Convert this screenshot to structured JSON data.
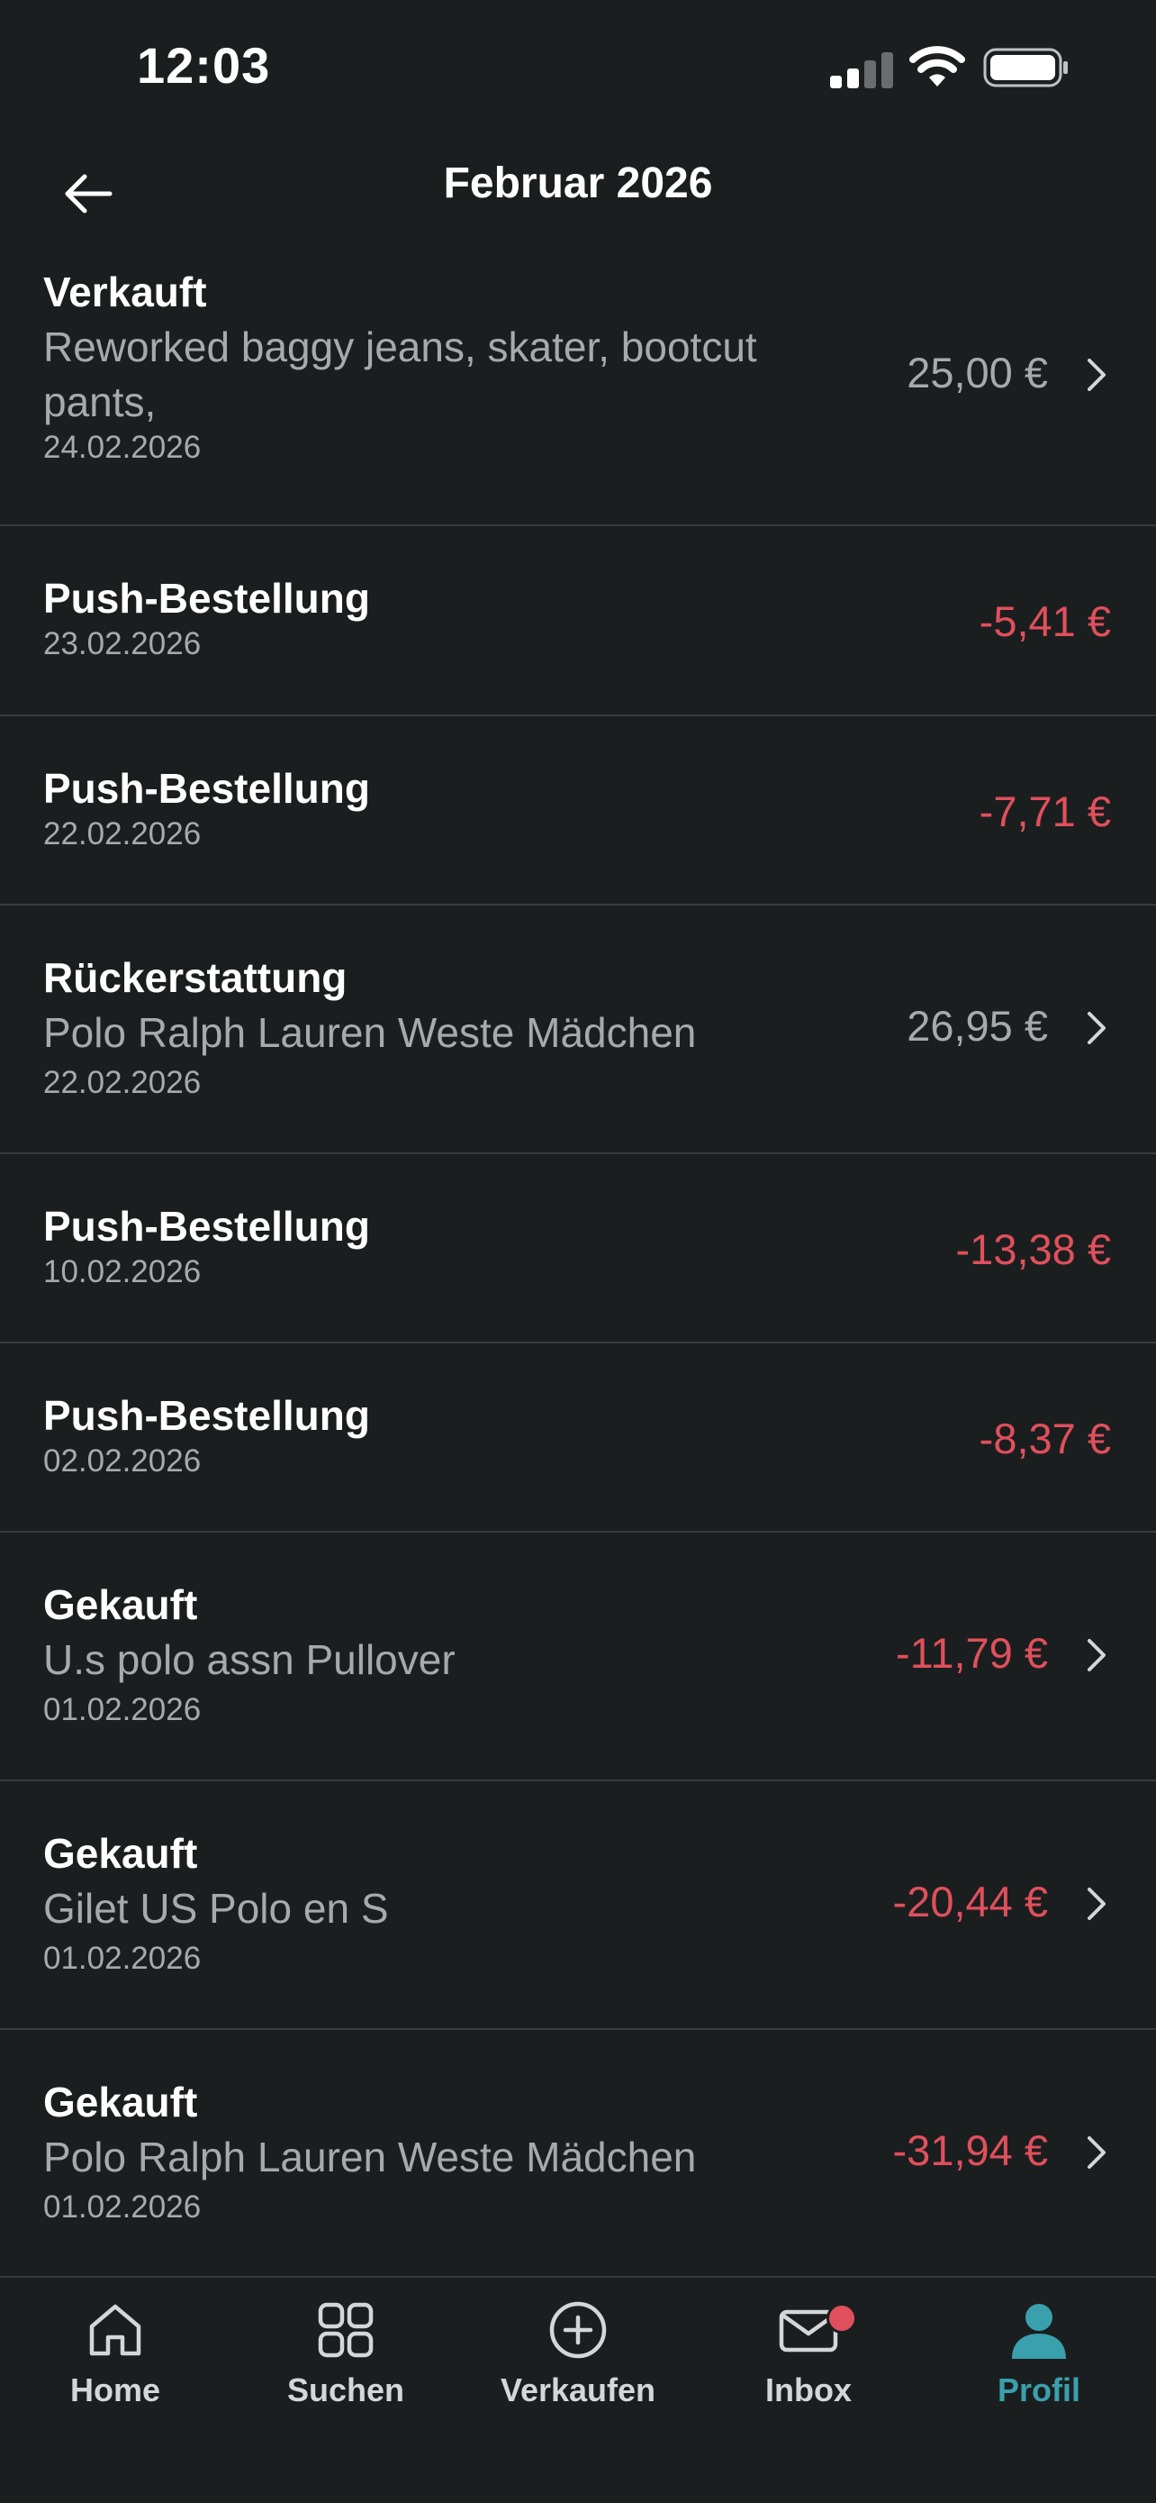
{
  "status_bar": {
    "time": "12:03",
    "signal_icon": "cellular-signal-icon",
    "wifi_icon": "wifi-icon",
    "battery_icon": "battery-icon"
  },
  "header": {
    "title": "Februar 2026",
    "back_icon": "arrow-left-icon"
  },
  "transactions": [
    {
      "title": "Verkauft",
      "subtitle_line1": "Reworked baggy jeans, skater, bootcut",
      "subtitle_line2": "pants,",
      "date": "24.02.2026",
      "amount": "25,00 €",
      "type": "positive",
      "has_chevron": true
    },
    {
      "title": "Push-Bestellung",
      "date": "23.02.2026",
      "amount": "-5,41 €",
      "type": "negative",
      "has_chevron": false
    },
    {
      "title": "Push-Bestellung",
      "date": "22.02.2026",
      "amount": "-7,71 €",
      "type": "negative",
      "has_chevron": false
    },
    {
      "title": "Rückerstattung",
      "subtitle_line1": "Polo Ralph Lauren Weste Mädchen",
      "date": "22.02.2026",
      "amount": "26,95 €",
      "type": "positive",
      "has_chevron": true
    },
    {
      "title": "Push-Bestellung",
      "date": "10.02.2026",
      "amount": "-13,38 €",
      "type": "negative",
      "has_chevron": false
    },
    {
      "title": "Push-Bestellung",
      "date": "02.02.2026",
      "amount": "-8,37 €",
      "type": "negative",
      "has_chevron": false
    },
    {
      "title": "Gekauft",
      "subtitle_line1": "U.s polo assn Pullover",
      "date": "01.02.2026",
      "amount": "-11,79 €",
      "type": "negative",
      "has_chevron": true
    },
    {
      "title": "Gekauft",
      "subtitle_line1": "Gilet US Polo en S",
      "date": "01.02.2026",
      "amount": "-20,44 €",
      "type": "negative",
      "has_chevron": true
    },
    {
      "title": "Gekauft",
      "subtitle_line1": "Polo Ralph Lauren Weste Mädchen",
      "date": "01.02.2026",
      "amount": "-31,94 €",
      "type": "negative",
      "has_chevron": true
    }
  ],
  "tabbar": {
    "home": {
      "label": "Home",
      "icon": "home-icon"
    },
    "search": {
      "label": "Suchen",
      "icon": "grid-icon"
    },
    "sell": {
      "label": "Verkaufen",
      "icon": "plus-circle-icon"
    },
    "inbox": {
      "label": "Inbox",
      "icon": "mail-icon",
      "has_badge": true
    },
    "profile": {
      "label": "Profil",
      "icon": "profile-icon",
      "active": true
    }
  },
  "colors": {
    "background": "#1b1e1f",
    "negative": "#e0505c",
    "secondary_text": "#a6aaac",
    "accent": "#3aa0ad",
    "divider": "#383c3e"
  }
}
